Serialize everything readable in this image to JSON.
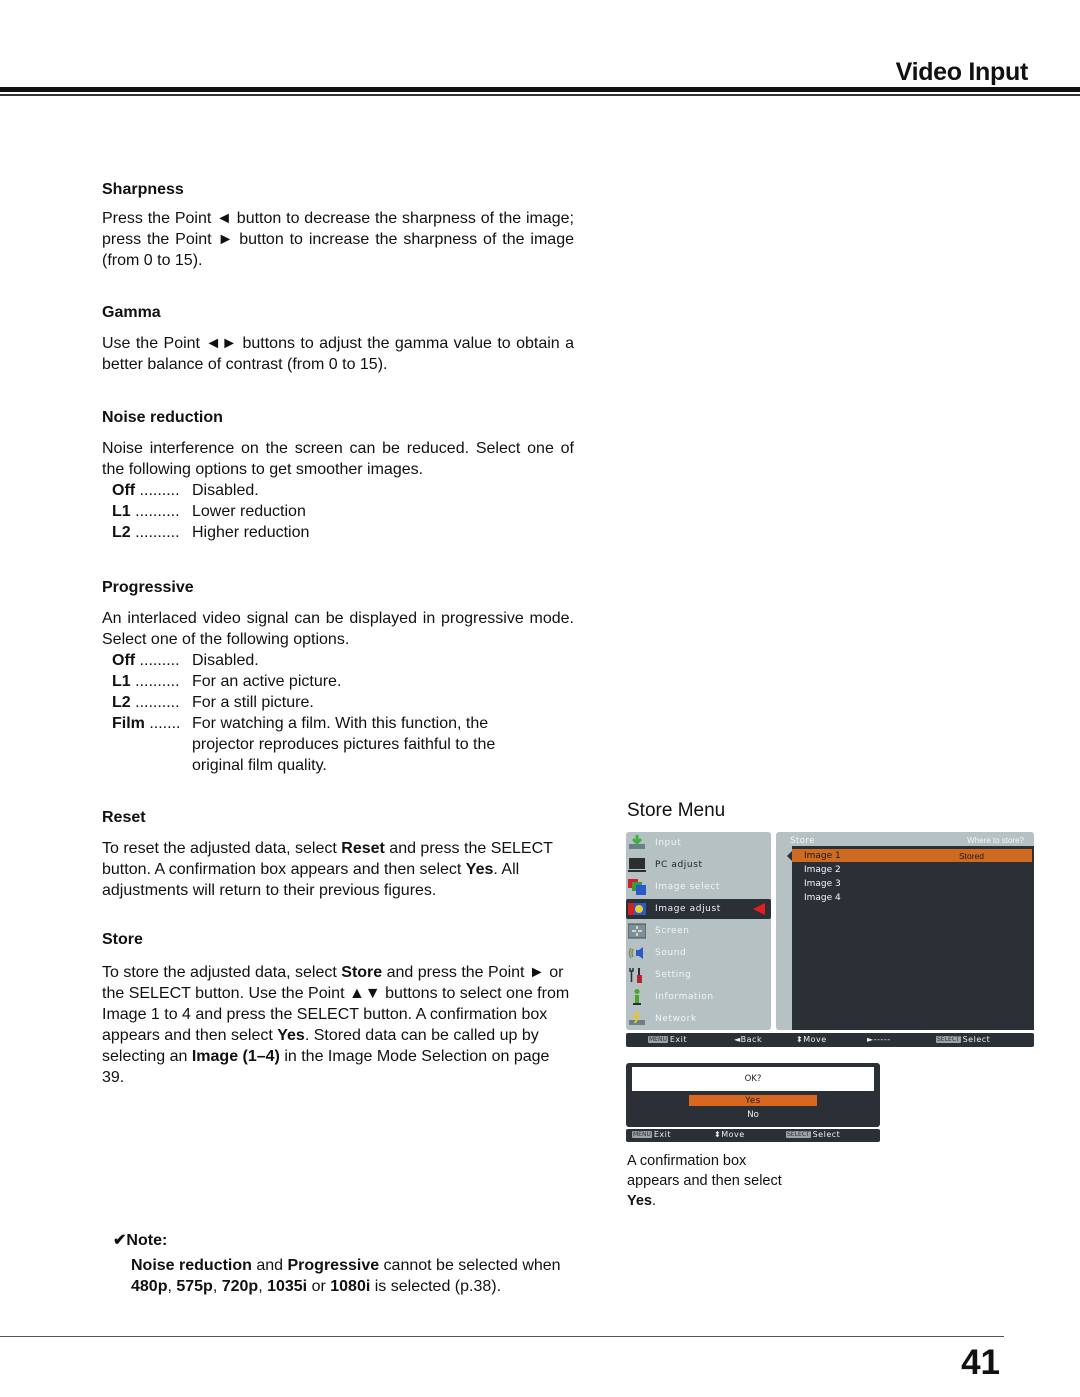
{
  "header": {
    "title": "Video Input"
  },
  "sections": {
    "sharpness": {
      "heading": "Sharpness",
      "body": "Press the Point ◄ button to decrease the sharpness of the image; press the Point ► button to increase the sharpness of the image (from 0 to 15)."
    },
    "gamma": {
      "heading": "Gamma",
      "body": "Use the Point ◄► buttons to adjust the gamma value to obtain a better balance of contrast (from 0 to 15)."
    },
    "noise_reduction": {
      "heading": "Noise reduction",
      "body": "Noise interference on the screen can be reduced. Select one of the following options to get smoother images.",
      "options": [
        {
          "key": "Off",
          "dots": " .........",
          "desc": "Disabled."
        },
        {
          "key": "L1",
          "dots": " ..........",
          "desc": "Lower reduction"
        },
        {
          "key": "L2",
          "dots": " ..........",
          "desc": "Higher reduction"
        }
      ]
    },
    "progressive": {
      "heading": "Progressive",
      "body": "An interlaced video signal can be displayed in progressive mode. Select one of the following options.",
      "options": [
        {
          "key": "Off",
          "dots": " .........",
          "desc": "Disabled."
        },
        {
          "key": "L1",
          "dots": " ..........",
          "desc": "For an active picture."
        },
        {
          "key": "L2",
          "dots": " ..........",
          "desc": "For a still picture."
        },
        {
          "key": "Film",
          "dots": " .......",
          "desc": "For watching a film. With this function, the projector reproduces pictures faithful to the original film quality."
        }
      ]
    },
    "reset": {
      "heading": "Reset",
      "body_parts": [
        "To reset the adjusted data, select ",
        "Reset",
        " and press the SELECT button. A confirmation box appears and then select ",
        "Yes",
        ". All adjustments will return to their previous figures."
      ]
    },
    "store": {
      "heading": "Store",
      "body_parts": [
        "To store the adjusted data, select ",
        "Store",
        " and press the Point ► or the SELECT button. Use the Point ▲▼ buttons to select one from Image 1 to 4 and press the SELECT button. A confirmation box appears and then select ",
        "Yes",
        ". Stored data can be called up by selecting an ",
        "Image (1–4)",
        " in the Image Mode Selection on page 39."
      ]
    }
  },
  "note": {
    "heading": "✔Note:",
    "body_parts": [
      "Noise reduction",
      " and ",
      "Progressive",
      " cannot be selected when ",
      "480p",
      ", ",
      "575p",
      ", ",
      "720p",
      ", ",
      "1035i",
      " or ",
      "1080i",
      " is selected (p.38)."
    ]
  },
  "store_menu": {
    "title": "Store Menu",
    "osd": {
      "menu_items": [
        {
          "label": "Input",
          "icon": "input-icon"
        },
        {
          "label": "PC adjust",
          "icon": "pc-adjust-icon"
        },
        {
          "label": "Image select",
          "icon": "image-select-icon"
        },
        {
          "label": "Image adjust",
          "icon": "image-adjust-icon",
          "selected": true
        },
        {
          "label": "Screen",
          "icon": "screen-icon"
        },
        {
          "label": "Sound",
          "icon": "sound-icon"
        },
        {
          "label": "Setting",
          "icon": "setting-icon"
        },
        {
          "label": "Information",
          "icon": "information-icon"
        },
        {
          "label": "Network",
          "icon": "network-icon"
        }
      ],
      "submenu_title": "Store",
      "submenu_hint": "Where to store?",
      "slots": [
        {
          "label": "Image 1",
          "status": "Stored",
          "selected": true
        },
        {
          "label": "Image 2",
          "status": ""
        },
        {
          "label": "Image 3",
          "status": ""
        },
        {
          "label": "Image 4",
          "status": ""
        }
      ],
      "bar": {
        "exit_key": "MENU",
        "exit": "Exit",
        "back": "◄Back",
        "move": "⬍Move",
        "next": "►-----",
        "select_key": "SELECT",
        "select": "Select"
      }
    },
    "confirm": {
      "question": "OK?",
      "yes": "Yes",
      "no": "No",
      "bar": {
        "exit_key": "MENU",
        "exit": "Exit",
        "move": "⬍Move",
        "select_key": "SELECT",
        "select": "Select"
      }
    },
    "caption_parts": [
      "A confirmation box appears and then select ",
      "Yes",
      "."
    ]
  },
  "colors": {
    "osd_panel": "#b5c1c3",
    "osd_dark": "#2a3035",
    "osd_highlight": "#cf6a22",
    "osd_pointer": "#e0201c"
  },
  "footer": {
    "page_number": "41"
  }
}
